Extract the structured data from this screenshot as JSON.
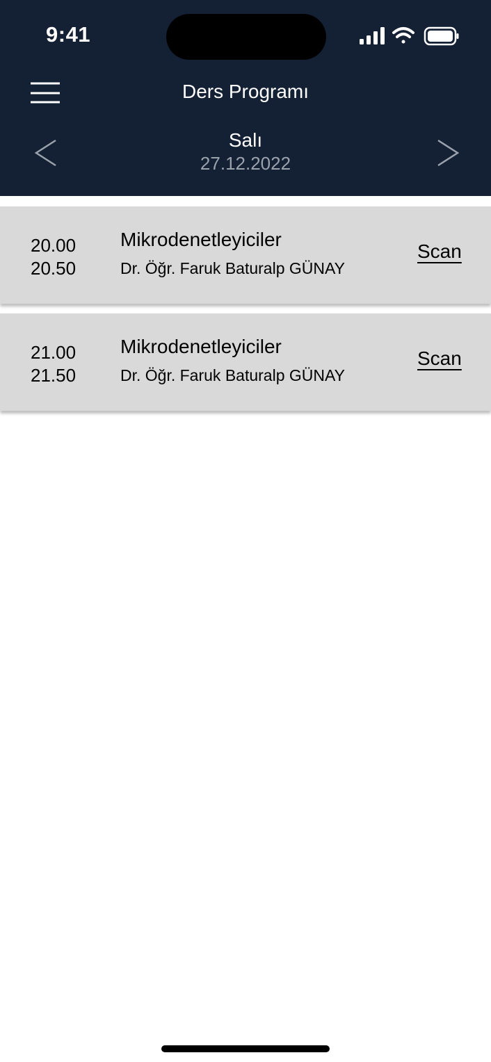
{
  "status_bar": {
    "time": "9:41",
    "icons": [
      "signal-icon",
      "wifi-icon",
      "battery-icon"
    ]
  },
  "header": {
    "title": "Ders Programı",
    "menu_icon": "hamburger-menu-icon",
    "prev_icon": "chevron-left-icon",
    "next_icon": "chevron-right-icon",
    "day_name": "Salı",
    "date": "27.12.2022"
  },
  "schedule": [
    {
      "start": "20.00",
      "end": "20.50",
      "course": "Mikrodenetleyiciler",
      "teacher": "Dr. Öğr. Faruk Baturalp GÜNAY",
      "action": "Scan"
    },
    {
      "start": "21.00",
      "end": "21.50",
      "course": "Mikrodenetleyiciler",
      "teacher": "Dr. Öğr. Faruk Baturalp GÜNAY",
      "action": "Scan"
    }
  ],
  "colors": {
    "header_bg": "#142033",
    "row_bg": "#d9d9d9",
    "date_text": "#9aa2ad",
    "text_primary": "#000000",
    "header_text": "#ffffff"
  }
}
